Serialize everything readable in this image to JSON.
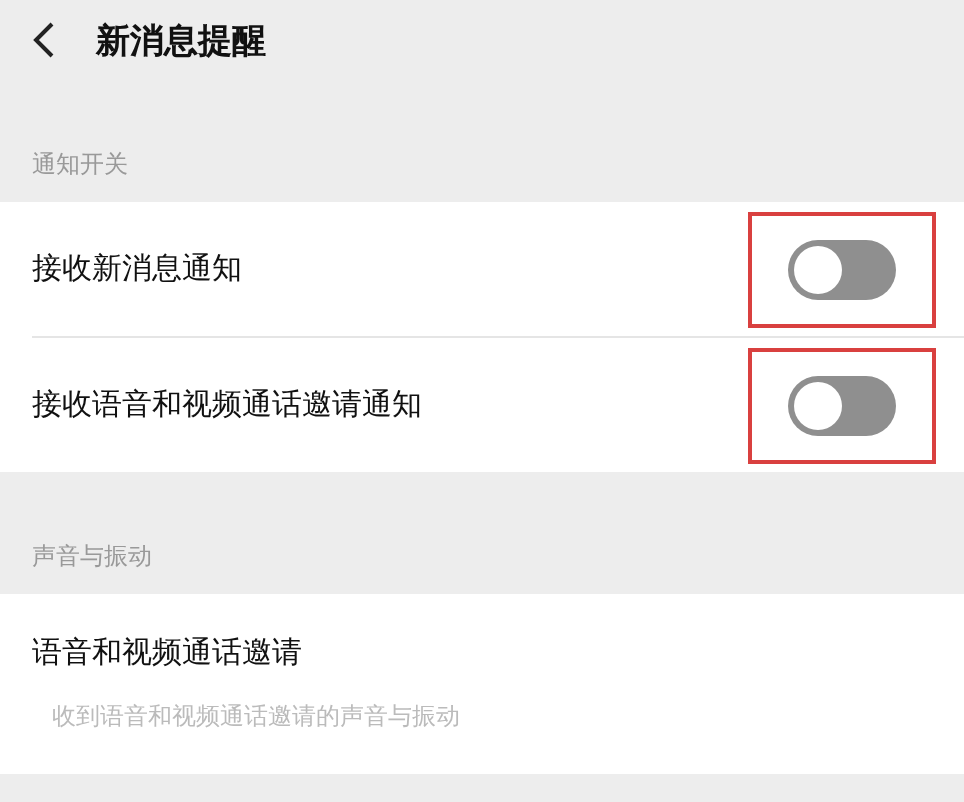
{
  "header": {
    "title": "新消息提醒"
  },
  "sections": [
    {
      "title": "通知开关",
      "items": [
        {
          "kind": "toggle",
          "label": "接收新消息通知",
          "on": false,
          "highlighted": true
        },
        {
          "kind": "toggle",
          "label": "接收语音和视频通话邀请通知",
          "on": false,
          "highlighted": true
        }
      ]
    },
    {
      "title": "声音与振动",
      "items": [
        {
          "kind": "link",
          "label": "语音和视频通话邀请",
          "description": "收到语音和视频通话邀请的声音与振动"
        }
      ]
    }
  ]
}
